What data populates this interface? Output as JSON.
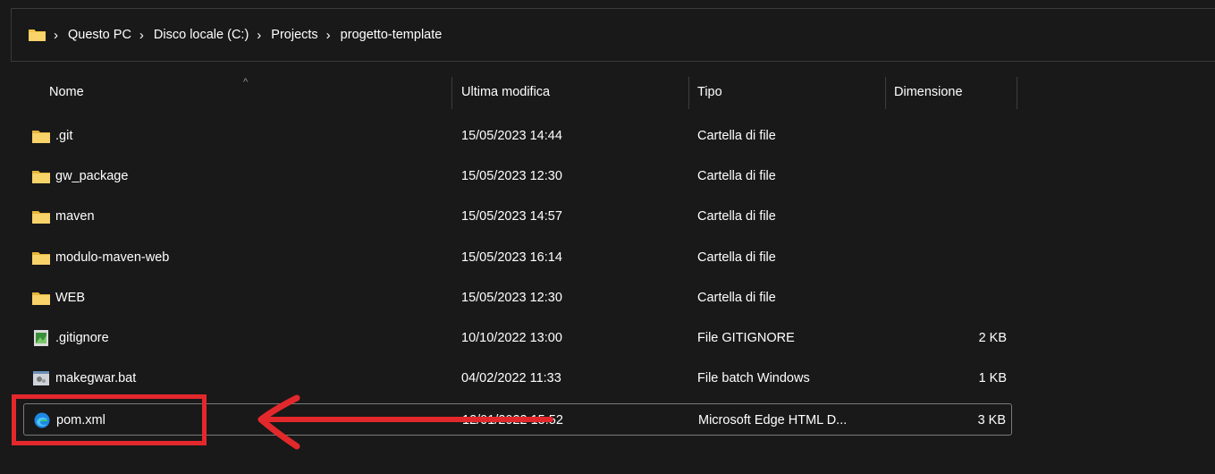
{
  "address_bar": {
    "crumbs": [
      "Questo PC",
      "Disco locale (C:)",
      "Projects",
      "progetto-template"
    ],
    "separator": "›"
  },
  "columns": {
    "name": "Nome",
    "modified": "Ultima modifica",
    "type": "Tipo",
    "size": "Dimensione",
    "sort_indicator": "^"
  },
  "files": [
    {
      "name": ".git",
      "modified": "15/05/2023 14:44",
      "type": "Cartella di file",
      "size": "",
      "icon": "folder-icon"
    },
    {
      "name": "gw_package",
      "modified": "15/05/2023 12:30",
      "type": "Cartella di file",
      "size": "",
      "icon": "folder-icon"
    },
    {
      "name": "maven",
      "modified": "15/05/2023 14:57",
      "type": "Cartella di file",
      "size": "",
      "icon": "folder-icon"
    },
    {
      "name": "modulo-maven-web",
      "modified": "15/05/2023 16:14",
      "type": "Cartella di file",
      "size": "",
      "icon": "folder-icon"
    },
    {
      "name": "WEB",
      "modified": "15/05/2023 12:30",
      "type": "Cartella di file",
      "size": "",
      "icon": "folder-icon"
    },
    {
      "name": ".gitignore",
      "modified": "10/10/2022 13:00",
      "type": "File GITIGNORE",
      "size": "2 KB",
      "icon": "generic-file-icon"
    },
    {
      "name": "makegwar.bat",
      "modified": "04/02/2022 11:33",
      "type": "File batch Windows",
      "size": "1 KB",
      "icon": "batch-file-icon"
    },
    {
      "name": "pom.xml",
      "modified": "12/01/2022 15:52",
      "type": "Microsoft Edge HTML D...",
      "size": "3 KB",
      "icon": "edge-icon"
    }
  ],
  "colors": {
    "background": "#191919",
    "folder": "#f5c544",
    "annotation": "#e3282c"
  }
}
